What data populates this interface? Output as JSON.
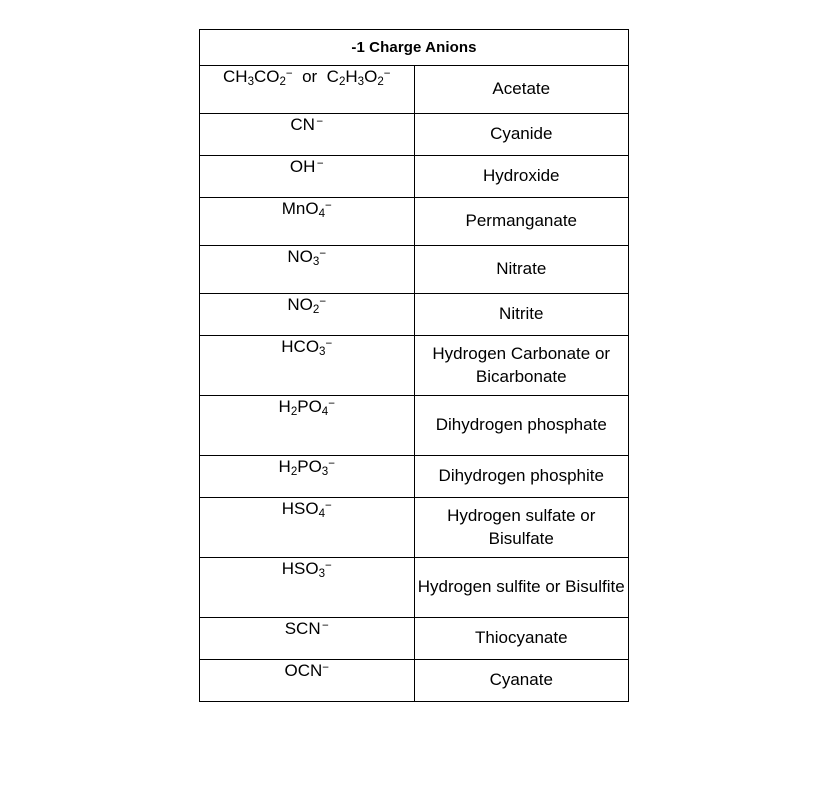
{
  "table": {
    "header": "-1 Charge Anions",
    "header_bg": "#c3c3c3",
    "border_color": "#000000",
    "page_bg": "#ffffff",
    "rows": [
      {
        "formula_plain": "CH3CO2- or C2H3O2-",
        "formula_html": "CH<sub>3</sub>CO<sub>2</sub><sup>&#8722;</sup>&nbsp; or &nbsp;C<sub>2</sub>H<sub>3</sub>O<sub>2</sub><sup>&#8722;</sup>",
        "name": "Acetate",
        "height_class": "r-tall"
      },
      {
        "formula_plain": "CN -",
        "formula_html": "CN&#8202;<sup>&#8722;</sup>",
        "name": "Cyanide",
        "height_class": "r-short"
      },
      {
        "formula_plain": "OH -",
        "formula_html": "OH&#8202;<sup>&#8722;</sup>",
        "name": "Hydroxide",
        "height_class": "r-short"
      },
      {
        "formula_plain": "MnO4-",
        "formula_html": "MnO<sub>4</sub><sup>&#8722;</sup>",
        "name": "Permanganate",
        "height_class": "r-tall"
      },
      {
        "formula_plain": "NO3-",
        "formula_html": "NO<sub>3</sub><sup>&#8722;</sup>",
        "name": "Nitrate",
        "height_class": "r-tall"
      },
      {
        "formula_plain": "NO2-",
        "formula_html": "NO<sub>2</sub><sup>&#8722;</sup>",
        "name": "Nitrite",
        "height_class": "r-short"
      },
      {
        "formula_plain": "HCO3-",
        "formula_html": "HCO<sub>3</sub><sup>&#8722;</sup>",
        "name": "Hydrogen Carbonate or Bicarbonate",
        "height_class": "r-two"
      },
      {
        "formula_plain": "H2PO4-",
        "formula_html": "H<sub>2</sub>PO<sub>4</sub><sup>&#8722;</sup>",
        "name": "Dihydrogen phosphate",
        "height_class": "r-two"
      },
      {
        "formula_plain": "H2PO3-",
        "formula_html": "H<sub>2</sub>PO<sub>3</sub><sup>&#8722;</sup>",
        "name": "Dihydrogen phosphite",
        "height_class": "r-short"
      },
      {
        "formula_plain": "HSO4-",
        "formula_html": "HSO<sub>4</sub><sup>&#8722;</sup>",
        "name": "Hydrogen sulfate or Bisulfate",
        "height_class": "r-two"
      },
      {
        "formula_plain": "HSO3-",
        "formula_html": "HSO<sub>3</sub><sup>&#8722;</sup>",
        "name": "Hydrogen sulfite or Bisulfite",
        "height_class": "r-two"
      },
      {
        "formula_plain": "SCN -",
        "formula_html": "SCN&#8202;<sup>&#8722;</sup>",
        "name": "Thiocyanate",
        "height_class": "r-short"
      },
      {
        "formula_plain": "OCN-",
        "formula_html": "OCN<sup>&#8722;</sup>",
        "name": "Cyanate",
        "height_class": "r-short"
      }
    ]
  }
}
